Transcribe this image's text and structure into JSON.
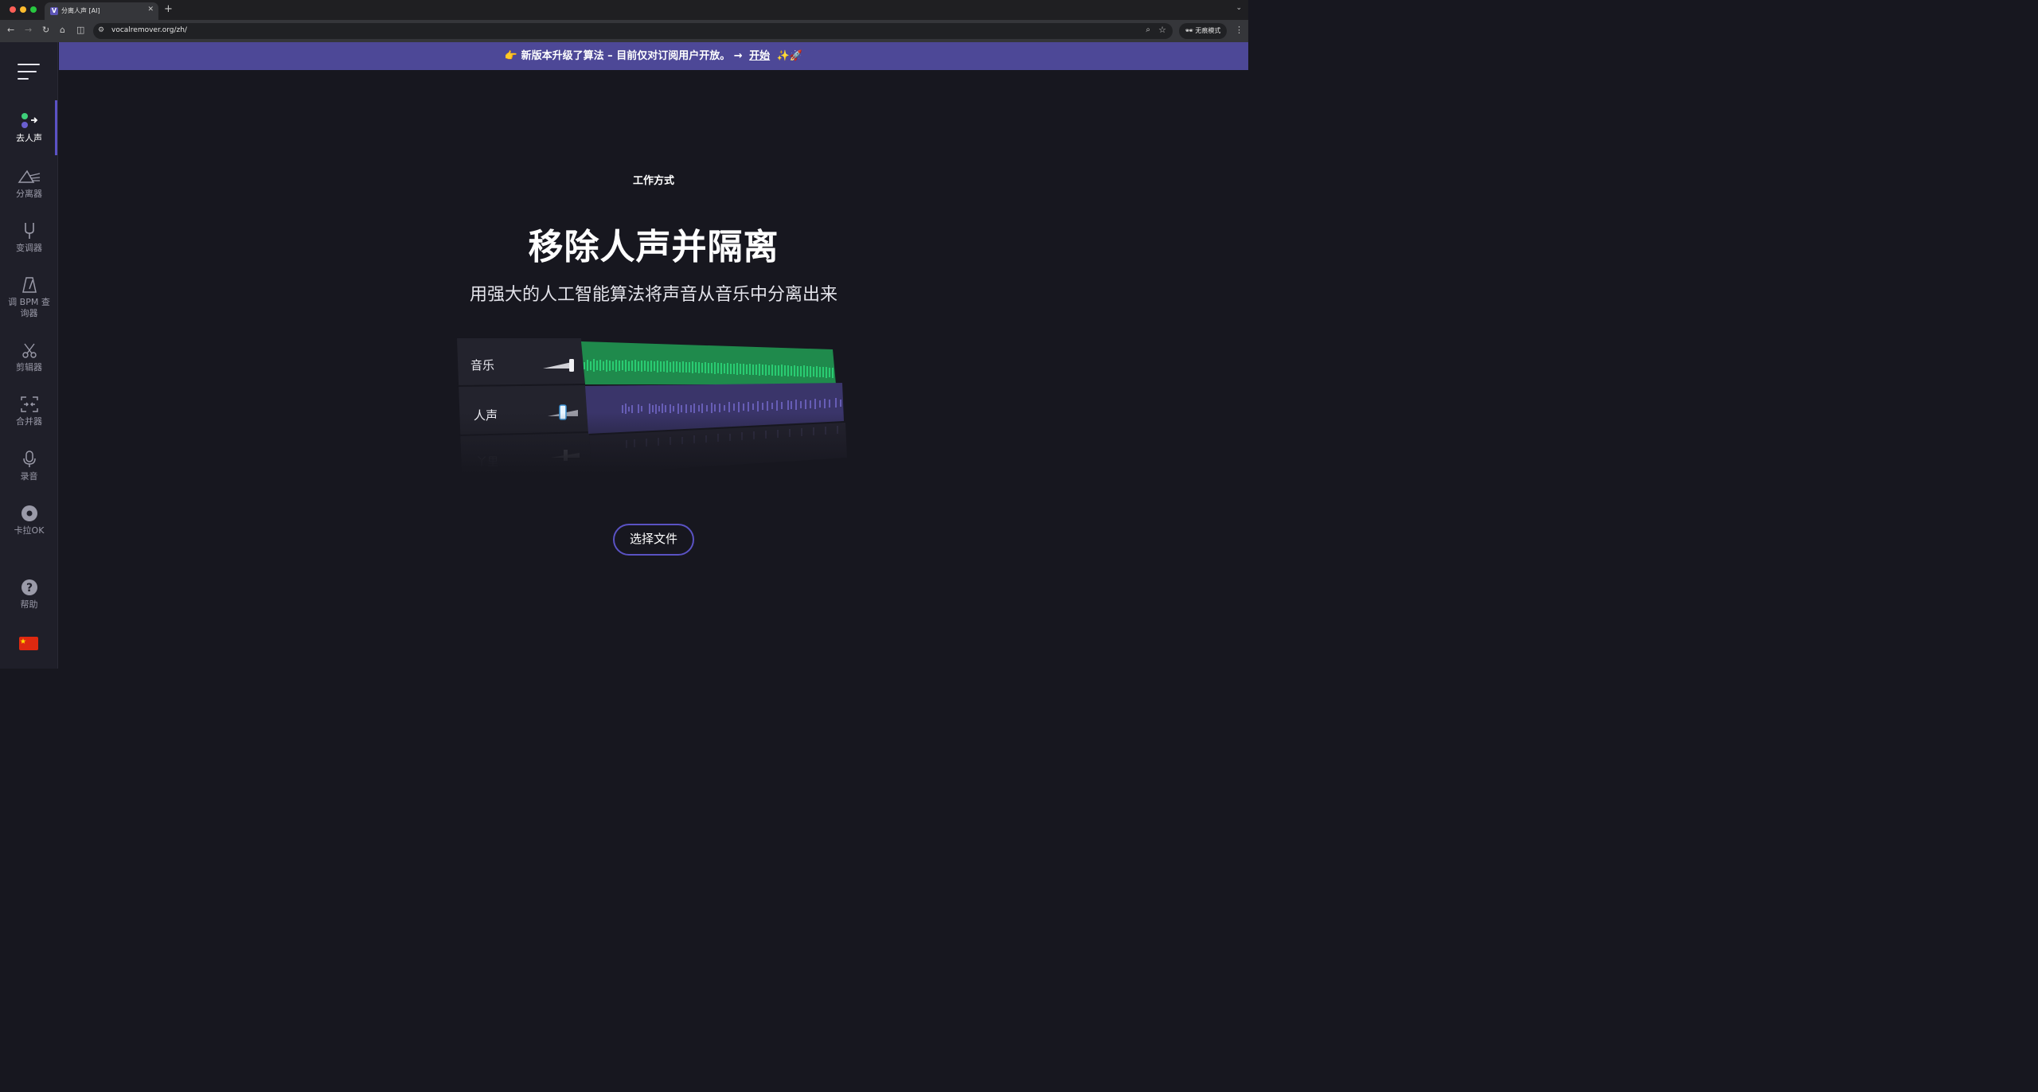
{
  "browser": {
    "tab_title": "分离人声 [AI]",
    "tab_favicon": "V",
    "url": "vocalremover.org/zh/",
    "profile_label": "无痕模式"
  },
  "sidebar": {
    "items": [
      {
        "label": "去人声",
        "icon": "vocal-remover-icon",
        "active": true
      },
      {
        "label": "分离器",
        "icon": "prism-splitter-icon"
      },
      {
        "label": "变调器",
        "icon": "tuning-fork-icon"
      },
      {
        "label": "调 BPM 查询器",
        "icon": "metronome-icon"
      },
      {
        "label": "剪辑器",
        "icon": "scissors-icon"
      },
      {
        "label": "合并器",
        "icon": "joiner-icon"
      },
      {
        "label": "录音",
        "icon": "microphone-icon"
      },
      {
        "label": "卡拉OK",
        "icon": "disc-icon"
      }
    ],
    "help_label": "帮助",
    "language_flag": "china-flag-icon"
  },
  "banner": {
    "emoji_left": "👉",
    "text": "新版本升级了算法 – 目前仅对订阅用户开放。 →",
    "link": "开始",
    "emoji_right": "✨🚀"
  },
  "hero": {
    "eyebrow": "工作方式",
    "title": "移除人声并隔离",
    "subtitle": "用强大的人工智能算法将声音从音乐中分离出来"
  },
  "illustration": {
    "tracks": [
      "音乐",
      "人声"
    ],
    "colors": {
      "music": "#2ecc71",
      "vocals": "#7b6fd6"
    }
  },
  "cta": {
    "label": "选择文件"
  },
  "colors": {
    "accent": "#5b52c5",
    "banner_bg": "#4d4897",
    "page_bg": "#17171f",
    "sidebar_bg": "#1f1f29"
  }
}
